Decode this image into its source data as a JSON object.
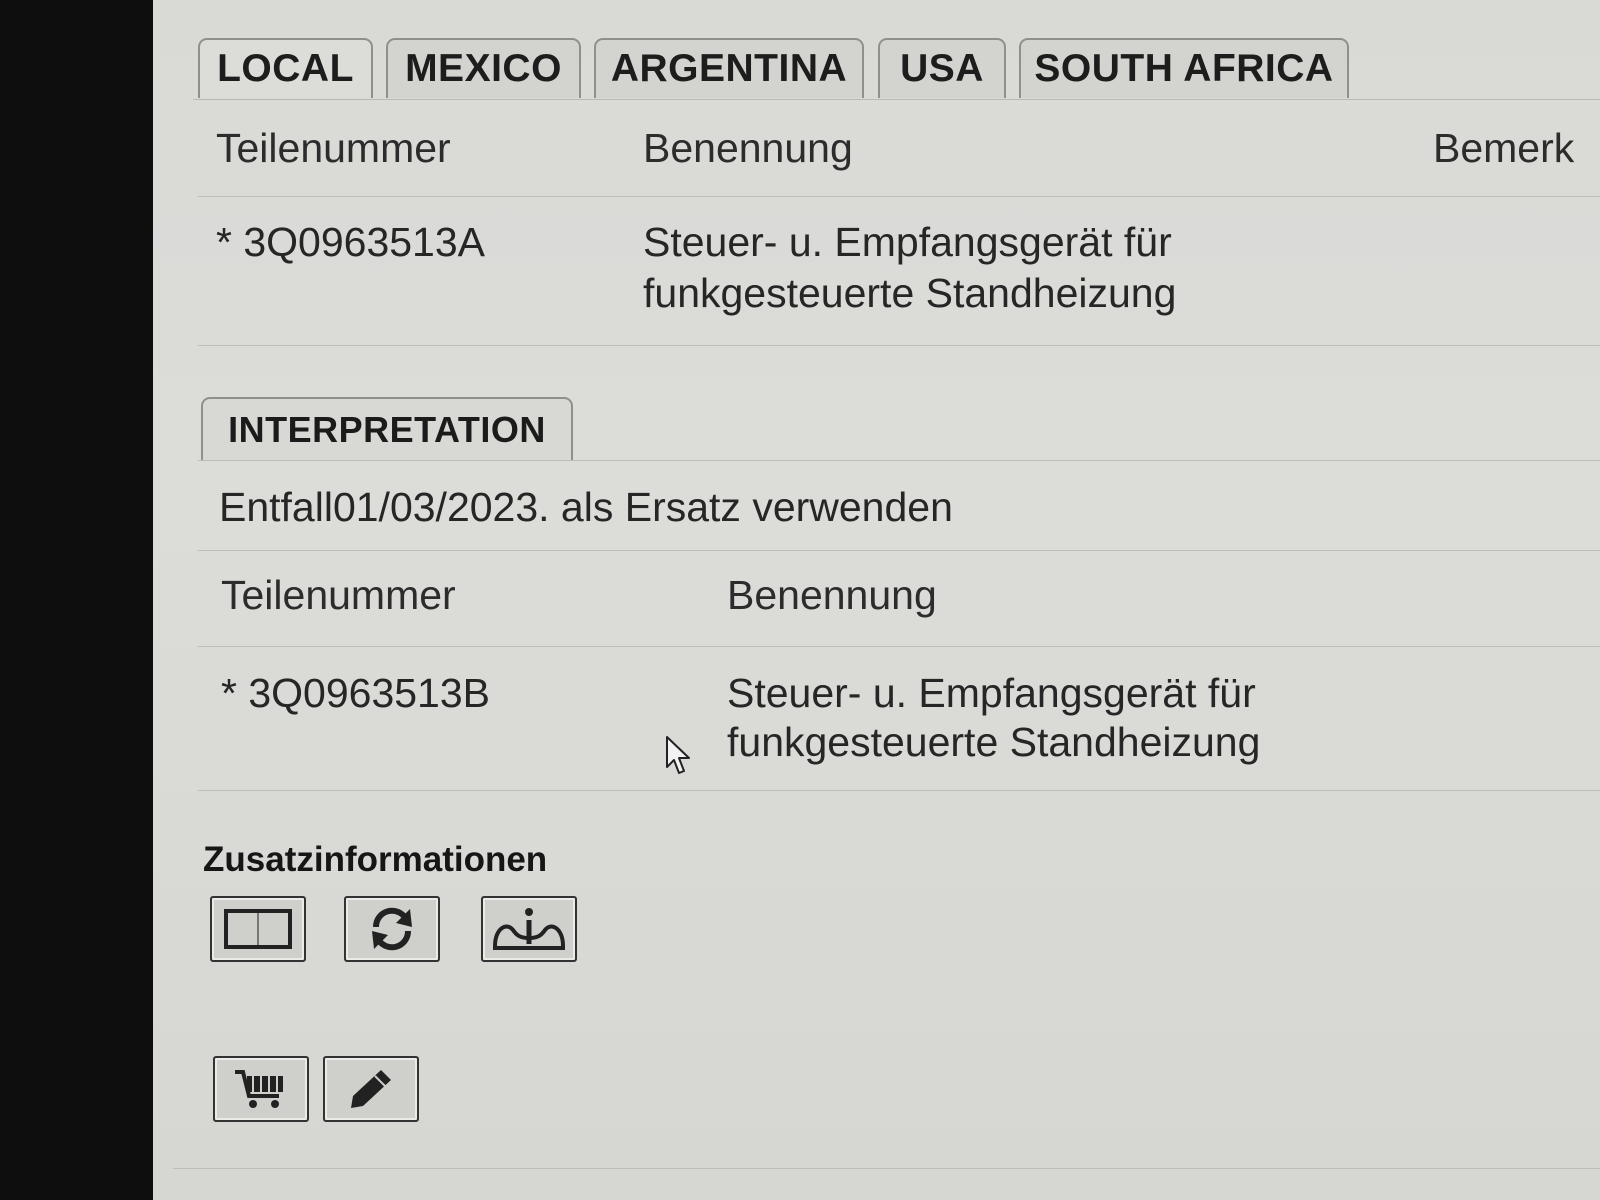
{
  "region_tabs": [
    "LOCAL",
    "MEXICO",
    "ARGENTINA",
    "USA",
    "SOUTH AFRICA"
  ],
  "main_table": {
    "headers": [
      "Teilenummer",
      "Benennung",
      "Bemerk"
    ],
    "row": {
      "part_number": "* 3Q0963513A",
      "description_line1": "Steuer- u. Empfangsgerät für",
      "description_line2": "funkgesteuerte Standheizung"
    }
  },
  "interpretation": {
    "tab_label": "INTERPRETATION",
    "note": "Entfall01/03/2023. als Ersatz verwenden",
    "headers": [
      "Teilenummer",
      "Benennung"
    ],
    "row": {
      "part_number": "* 3Q0963513B",
      "description_line1": "Steuer- u. Empfangsgerät für",
      "description_line2": "funkgesteuerte Standheizung"
    }
  },
  "additional_info": {
    "title": "Zusatzinformationen",
    "buttons": [
      "book-icon",
      "refresh-icon",
      "person-info-icon"
    ]
  },
  "actions": {
    "buttons": [
      "shopping-cart-icon",
      "pencil-icon"
    ]
  }
}
